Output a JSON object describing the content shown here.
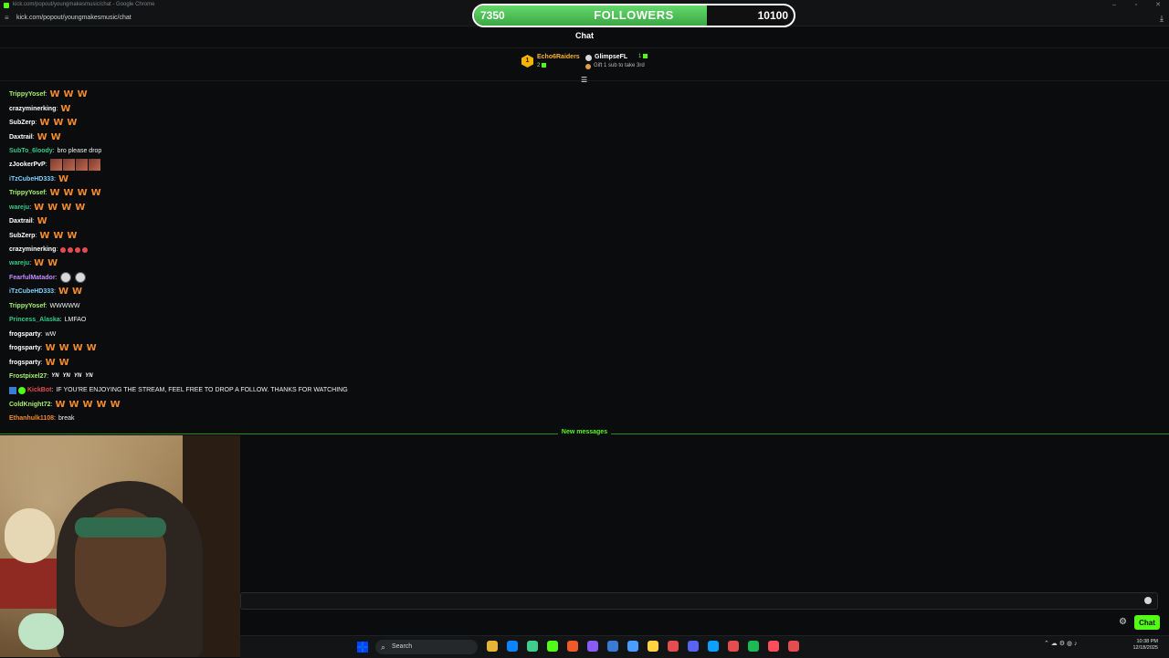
{
  "browser": {
    "window_title": "kick.com/popout/youngmakesmusic/chat - Google Chrome",
    "url": "kick.com/popout/youngmakesmusic/chat",
    "controls": {
      "minimize": "–",
      "maximize": "▫",
      "close": "✕"
    }
  },
  "followers": {
    "current": "7350",
    "label": "FOLLOWERS",
    "goal": "10100",
    "progress": 0.728
  },
  "chat": {
    "title": "Chat",
    "leaderboard": {
      "first": {
        "rank": "1",
        "name": "Echo6Raiders",
        "count": "2"
      },
      "second": {
        "name": "GlimpseFL",
        "count": "1"
      },
      "gift_hint": "Gift 1 sub to take 3rd"
    },
    "new_messages_label": "New messages",
    "input_placeholder": "",
    "send_label": "Chat"
  },
  "messages": [
    {
      "user": "TrippyYosef",
      "color": "#a6f06b",
      "emotes": "w3"
    },
    {
      "user": "crazyminerking",
      "color": "#ffffff",
      "emotes": "bat1"
    },
    {
      "user": "SubZerp",
      "color": "#ffffff",
      "emotes": "w3"
    },
    {
      "user": "Daxtrail",
      "color": "#ffffff",
      "emotes": "w2"
    },
    {
      "user": "SubTo_6loody",
      "color": "#34c98a",
      "text": "bro please drop"
    },
    {
      "user": "zJookerPvP",
      "color": "#ffffff",
      "emotes": "img4"
    },
    {
      "user": "iTzCubeHD333",
      "color": "#7fd1ff",
      "emotes": "bat1"
    },
    {
      "user": "TrippyYosef",
      "color": "#a6f06b",
      "emotes": "bat4"
    },
    {
      "user": "wareju",
      "color": "#34c98a",
      "emotes": "w4"
    },
    {
      "user": "Daxtrail",
      "color": "#ffffff",
      "emotes": "bat1"
    },
    {
      "user": "SubZerp",
      "color": "#ffffff",
      "emotes": "bat3"
    },
    {
      "user": "crazyminerking",
      "color": "#ffffff",
      "emotes": "red4"
    },
    {
      "user": "wareju",
      "color": "#34c98a",
      "emotes": "bat2"
    },
    {
      "user": "FearfulMatador",
      "color": "#c48bff",
      "emotes": "face2"
    },
    {
      "user": "iTzCubeHD333",
      "color": "#7fd1ff",
      "emotes": "w2"
    },
    {
      "user": "TrippyYosef",
      "color": "#a6f06b",
      "text": "WWWWW"
    },
    {
      "user": "Princess_Alaska",
      "color": "#34c98a",
      "text": "LMFAO"
    },
    {
      "user": "frogsparty",
      "color": "#ffffff",
      "text": "wW"
    },
    {
      "user": "frogsparty",
      "color": "#ffffff",
      "emotes": "w4"
    },
    {
      "user": "frogsparty",
      "color": "#ffffff",
      "emotes": "bat2"
    },
    {
      "user": "Frostpixel27",
      "color": "#a6f06b",
      "emotes": "yn4"
    },
    {
      "user": "KickBot",
      "color": "#e34d4d",
      "badges": true,
      "text": "IF YOU'RE ENJOYING THE STREAM, FEEL FREE TO DROP A FOLLOW. THANKS FOR WATCHING"
    },
    {
      "user": "ColdKnight72",
      "color": "#a6f06b",
      "emotes": "w5"
    },
    {
      "user": "Ethanhulk1108",
      "color": "#f28a2e",
      "text": "break"
    }
  ],
  "emote_text": {
    "w": "W",
    "yn": "YN",
    "bat": "♥"
  },
  "taskbar": {
    "search_label": "Search",
    "tray_icons": "⌃ ☁ ⚙ ◍ ♪",
    "time": "10:38 PM",
    "date": "12/18/2025",
    "icons": [
      "#e6b533",
      "#0a84ff",
      "#3ecf8e",
      "#53fc18",
      "#f05a28",
      "#8a5cf6",
      "#3a7bd5",
      "#4a9cff",
      "#ffd23f",
      "#e34d4d",
      "#5865f2",
      "#0aa1ff",
      "#e34d4d",
      "#1db954",
      "#ff4d5a",
      "#e34d4d"
    ]
  }
}
